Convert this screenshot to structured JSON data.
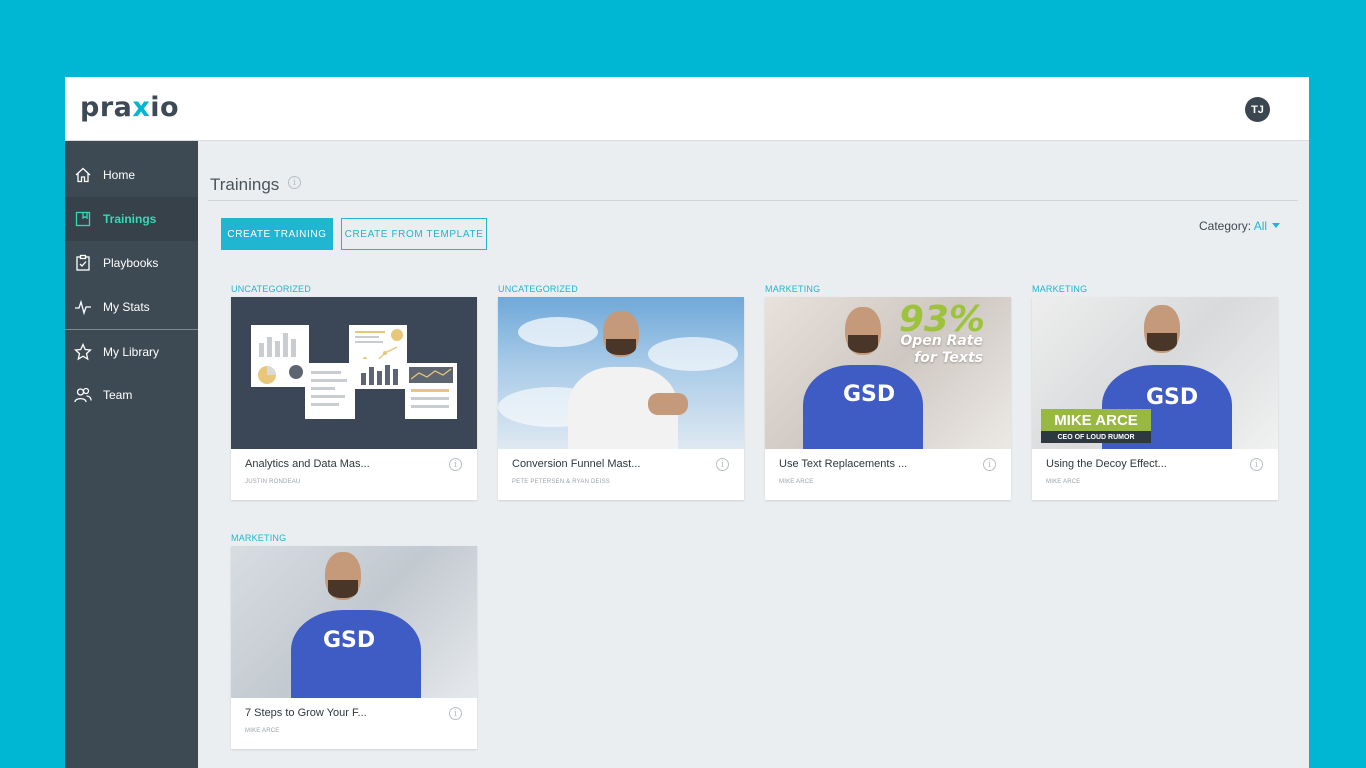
{
  "app": {
    "logo_prefix": "pra",
    "logo_x": "x",
    "logo_suffix": "io",
    "avatar_initials": "TJ"
  },
  "sidebar": {
    "items": [
      {
        "label": "Home",
        "icon": "home-icon"
      },
      {
        "label": "Trainings",
        "icon": "trainings-icon",
        "active": true
      },
      {
        "label": "Playbooks",
        "icon": "clipboard-check-icon"
      },
      {
        "label": "My Stats",
        "icon": "pulse-icon"
      },
      {
        "label": "My Library",
        "icon": "star-icon"
      },
      {
        "label": "Team",
        "icon": "team-icon"
      }
    ]
  },
  "main": {
    "title": "Trainings",
    "create_button": "CREATE TRAINING",
    "template_button": "CREATE FROM TEMPLATE",
    "category_label": "Category:",
    "category_value": "All"
  },
  "cards": [
    {
      "category": "UNCATEGORIZED",
      "title": "Analytics and Data Mas...",
      "author": "JUSTIN RONDEAU"
    },
    {
      "category": "UNCATEGORIZED",
      "title": "Conversion Funnel Mast...",
      "author": "PETE PETERSEN & RYAN DEISS"
    },
    {
      "category": "MARKETING",
      "title": "Use Text Replacements ...",
      "author": "MIKE ARCE",
      "overlay_big": "93%",
      "overlay_line1": "Open Rate",
      "overlay_line2": "for Texts",
      "shirt_text": "GSD"
    },
    {
      "category": "MARKETING",
      "title": "Using the Decoy Effect...",
      "author": "MIKE ARCE",
      "name_tag": "MIKE ARCE",
      "name_sub": "CEO OF LOUD RUMOR",
      "shirt_text": "GSD"
    },
    {
      "category": "MARKETING",
      "title": "7 Steps to Grow Your F...",
      "author": "MIKE ARCE",
      "shirt_text": "GSD"
    }
  ],
  "colors": {
    "accent": "#20b5d0",
    "sidebar_bg": "#3e4a53",
    "active_nav": "#36d9b6",
    "page_bg": "#00b7d3"
  }
}
